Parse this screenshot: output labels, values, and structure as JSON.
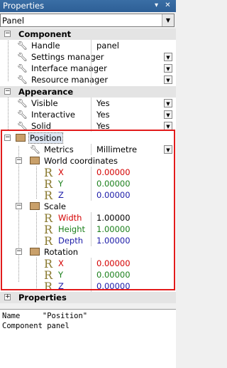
{
  "window": {
    "title": "Properties",
    "pin_glyph": "▾ ⊥",
    "close_glyph": "✕"
  },
  "object_selector": {
    "value": "Panel"
  },
  "categories": {
    "component": {
      "label": "Component",
      "props": [
        {
          "label": "Handle",
          "value": "panel"
        },
        {
          "label": "Settings manager",
          "value": ""
        },
        {
          "label": "Interface manager",
          "value": ""
        },
        {
          "label": "Resource manager",
          "value": ""
        }
      ]
    },
    "appearance": {
      "label": "Appearance",
      "props": [
        {
          "label": "Visible",
          "value": "Yes"
        },
        {
          "label": "Interactive",
          "value": "Yes"
        },
        {
          "label": "Solid",
          "value": "Yes"
        }
      ]
    },
    "position": {
      "label": "Position",
      "metrics": {
        "label": "Metrics",
        "value": "Millimetre"
      },
      "world": {
        "label": "World coordinates",
        "x": {
          "label": "X",
          "value": "0.00000"
        },
        "y": {
          "label": "Y",
          "value": "0.00000"
        },
        "z": {
          "label": "Z",
          "value": "0.00000"
        }
      },
      "scale": {
        "label": "Scale",
        "w": {
          "label": "Width",
          "value": "1.00000"
        },
        "h": {
          "label": "Height",
          "value": "1.00000"
        },
        "d": {
          "label": "Depth",
          "value": "1.00000"
        }
      },
      "rotation": {
        "label": "Rotation",
        "x": {
          "label": "X",
          "value": "0.00000"
        },
        "y": {
          "label": "Y",
          "value": "0.00000"
        },
        "z": {
          "label": "Z",
          "value": "0.00000"
        }
      }
    },
    "properties": {
      "label": "Properties"
    }
  },
  "info": {
    "line1": "Name     \"Position\"",
    "line2": "Component panel"
  },
  "colors": {
    "highlight": "#e21b1b",
    "x": "#d40000",
    "y": "#1a7f1a",
    "z": "#1a1aa8"
  }
}
